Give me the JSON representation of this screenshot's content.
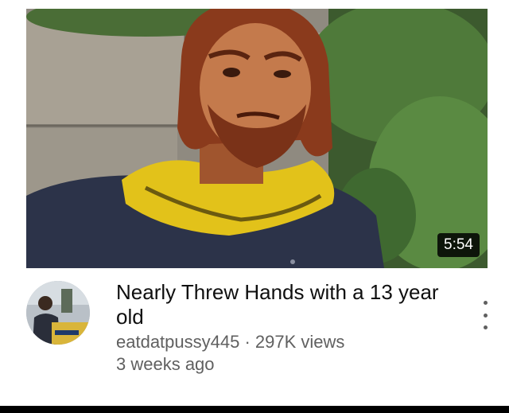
{
  "video": {
    "title": "Nearly Threw Hands with a 13 year old",
    "duration": "5:54",
    "channel": "eatdatpussy445",
    "separator": " · ",
    "views": "297K views",
    "age": "3 weeks ago"
  },
  "icons": {
    "more": "vertical-ellipsis-icon"
  },
  "colors": {
    "title_text": "#0f0f0f",
    "secondary_text": "#606060",
    "badge_bg": "#000000",
    "scarf_yellow": "#e2c21a",
    "hair_red": "#8a3a1c"
  }
}
